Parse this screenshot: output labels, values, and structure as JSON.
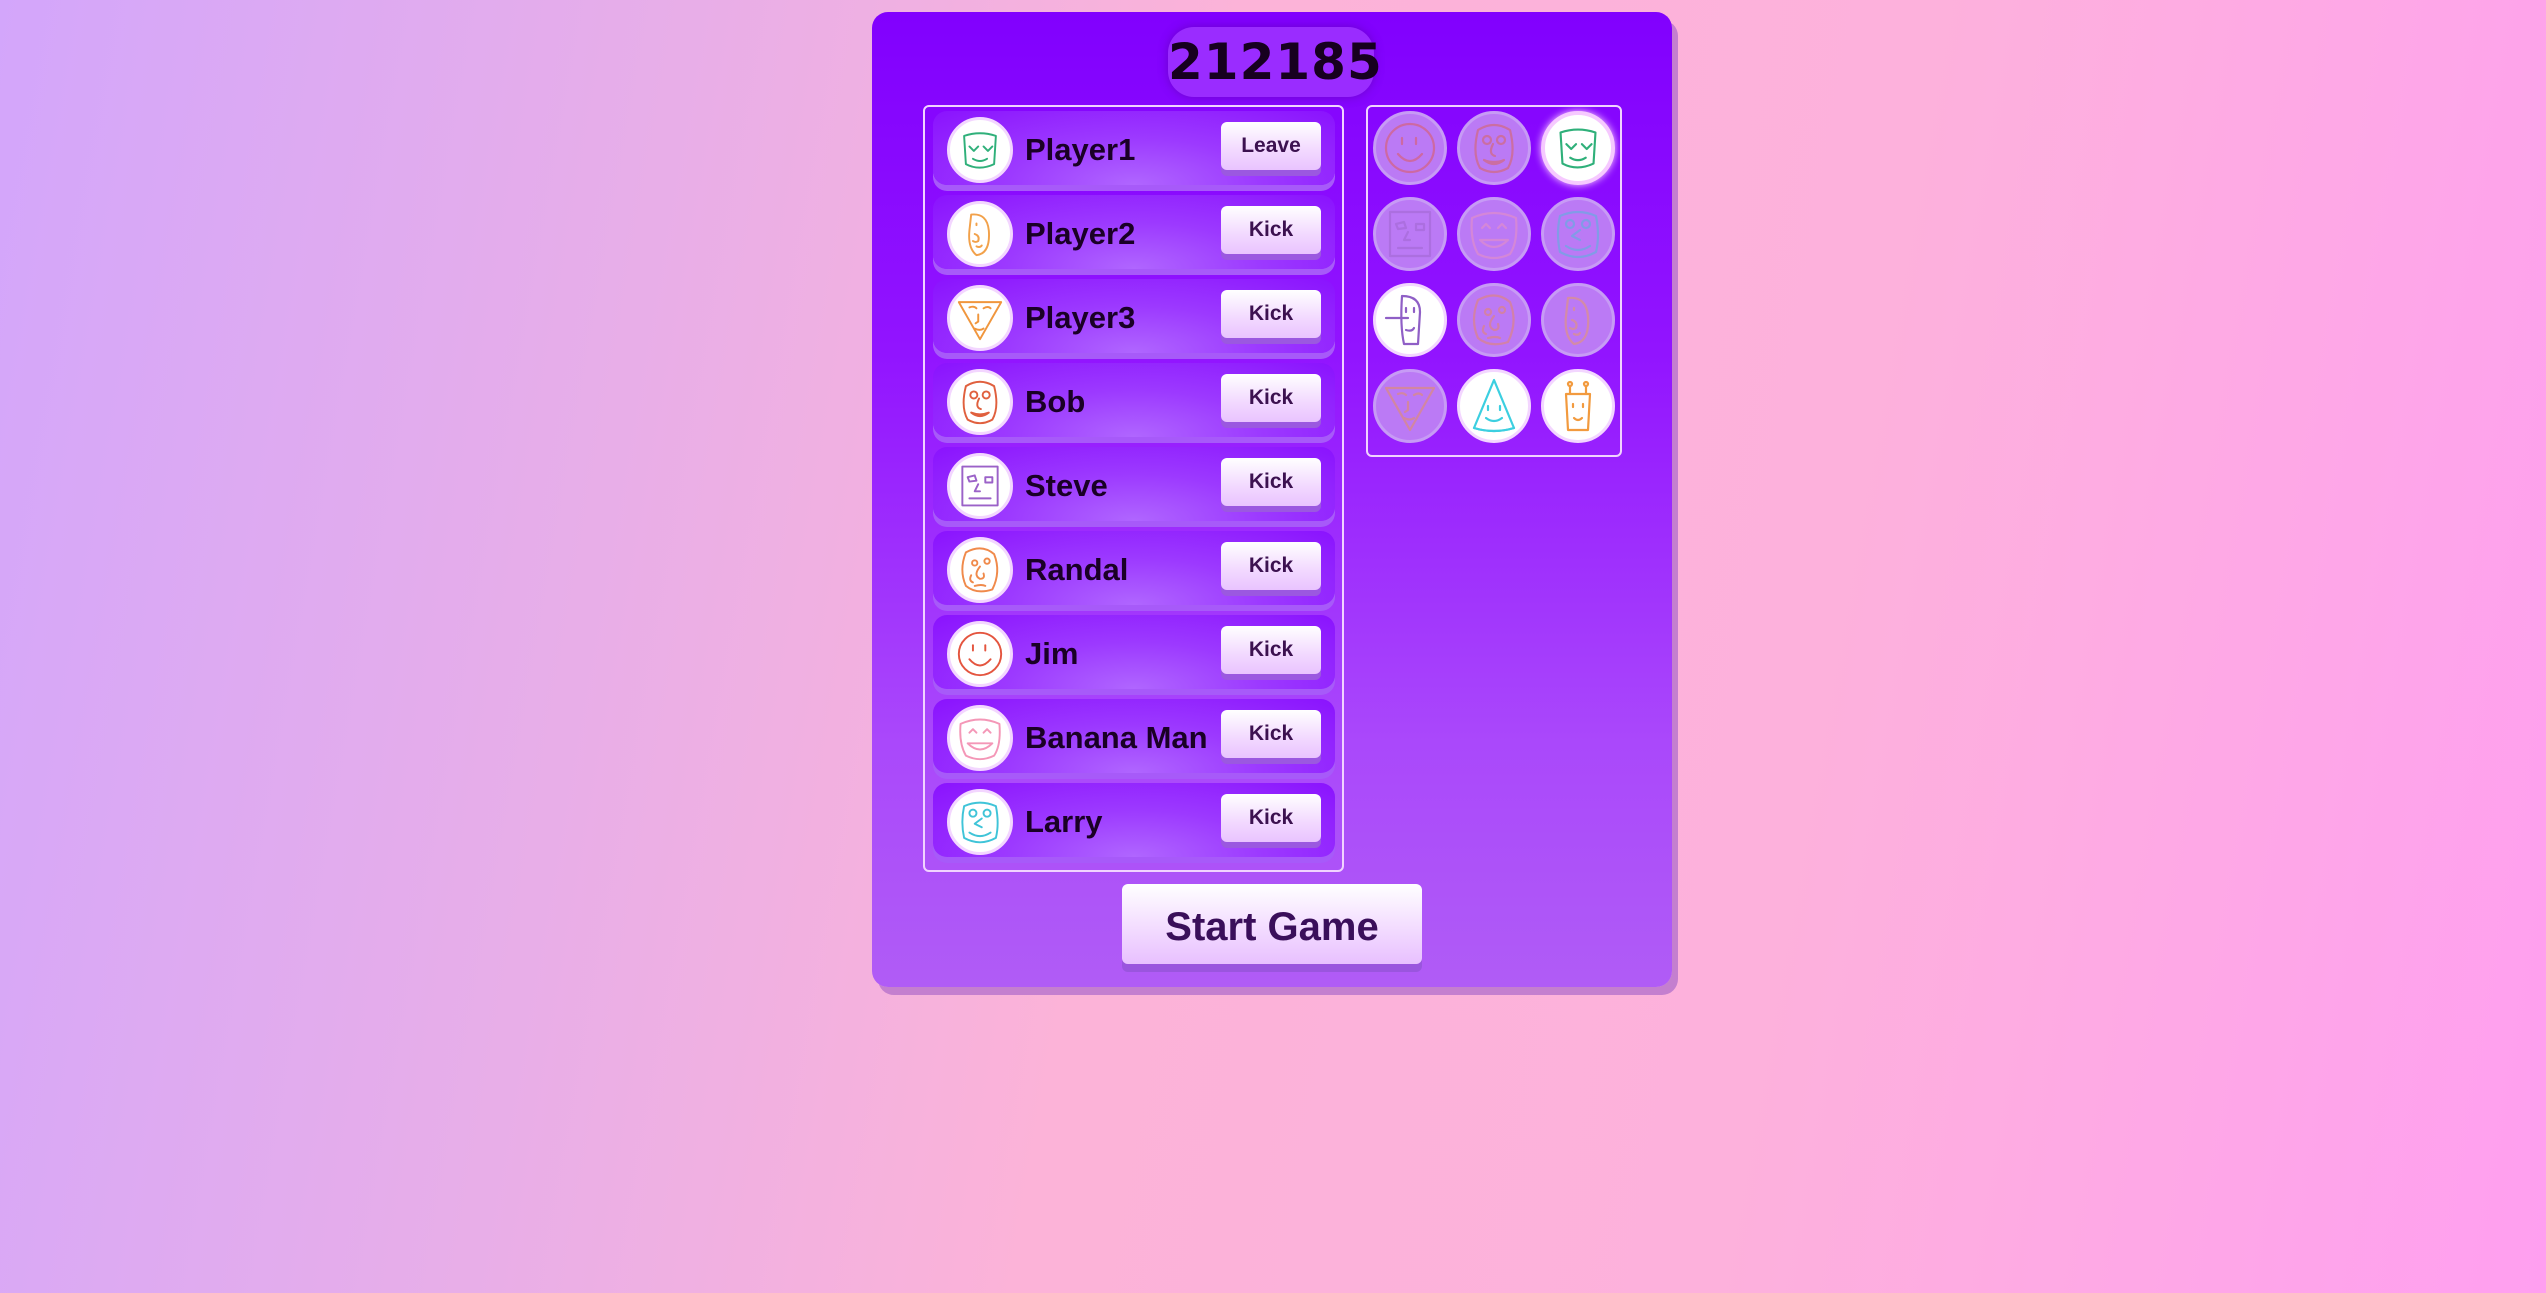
{
  "room_code": "212185",
  "players": [
    {
      "name": "Player1",
      "action": "Leave",
      "avatar": "face-green-smile",
      "color": "#2fb07a"
    },
    {
      "name": "Player2",
      "action": "Kick",
      "avatar": "face-long-orange",
      "color": "#f2a14a"
    },
    {
      "name": "Player3",
      "action": "Kick",
      "avatar": "face-triangle-orange",
      "color": "#f0963d"
    },
    {
      "name": "Bob",
      "action": "Kick",
      "avatar": "face-round-red",
      "color": "#e0603e"
    },
    {
      "name": "Steve",
      "action": "Kick",
      "avatar": "face-square-purple",
      "color": "#9b62c8"
    },
    {
      "name": "Randal",
      "action": "Kick",
      "avatar": "face-lumpy-orange",
      "color": "#f08a4b"
    },
    {
      "name": "Jim",
      "action": "Kick",
      "avatar": "face-circle-red",
      "color": "#e4553f"
    },
    {
      "name": "Banana Man",
      "action": "Kick",
      "avatar": "face-wide-pink",
      "color": "#f497b7"
    },
    {
      "name": "Larry",
      "action": "Kick",
      "avatar": "face-blob-cyan",
      "color": "#3fc4d8"
    }
  ],
  "avatar_choices": [
    {
      "icon": "face-circle-red",
      "state": "taken",
      "color": "#e4553f"
    },
    {
      "icon": "face-round-red",
      "state": "taken",
      "color": "#e0603e"
    },
    {
      "icon": "face-green-smile",
      "state": "selected",
      "color": "#2fb07a"
    },
    {
      "icon": "face-square-purple",
      "state": "taken",
      "color": "#9b62c8"
    },
    {
      "icon": "face-wide-pink",
      "state": "taken",
      "color": "#f497b7"
    },
    {
      "icon": "face-blob-cyan",
      "state": "taken",
      "color": "#3fc4d8"
    },
    {
      "icon": "face-long-purple",
      "state": "free",
      "color": "#8f5fc6"
    },
    {
      "icon": "face-lumpy-orange",
      "state": "taken",
      "color": "#f08a4b"
    },
    {
      "icon": "face-long-orange",
      "state": "taken",
      "color": "#f2a14a"
    },
    {
      "icon": "face-triangle-orange",
      "state": "taken",
      "color": "#f0963d"
    },
    {
      "icon": "face-cone-cyan",
      "state": "free",
      "color": "#3ccfe0"
    },
    {
      "icon": "face-giraffe-orange",
      "state": "free",
      "color": "#f29a3e"
    }
  ],
  "start_button": "Start Game",
  "colors": {
    "panel_top": "#8100fe",
    "panel_bottom": "#b05cf6",
    "button_text": "#3a0f5a"
  }
}
